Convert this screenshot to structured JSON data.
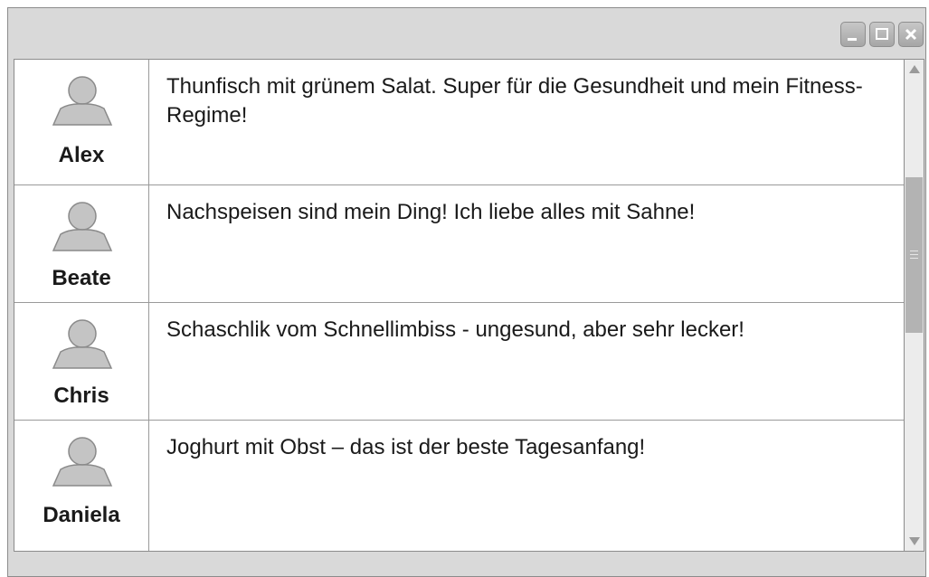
{
  "window": {
    "controls": [
      {
        "icon": "minimize-icon"
      },
      {
        "icon": "maximize-icon"
      },
      {
        "icon": "close-icon"
      }
    ]
  },
  "chat": {
    "messages": [
      {
        "user": "Alex",
        "avatar_icon": "user-avatar-icon",
        "text": "Thunfisch mit grünem Salat. Super für die Gesundheit und mein Fitness-Regime!"
      },
      {
        "user": "Beate",
        "avatar_icon": "user-avatar-icon",
        "text": "Nachspeisen sind mein Ding! Ich liebe alles mit Sahne!"
      },
      {
        "user": "Chris",
        "avatar_icon": "user-avatar-icon",
        "text": "Schaschlik vom Schnellimbiss - ungesund, aber sehr lecker!"
      },
      {
        "user": "Daniela",
        "avatar_icon": "user-avatar-icon",
        "text": "Joghurt mit Obst – das ist der beste Tagesanfang!"
      }
    ]
  },
  "colors": {
    "window_bg": "#d9d9d9",
    "avatar_fill": "#c4c4c4",
    "scroll_thumb": "#b3b3b3"
  }
}
